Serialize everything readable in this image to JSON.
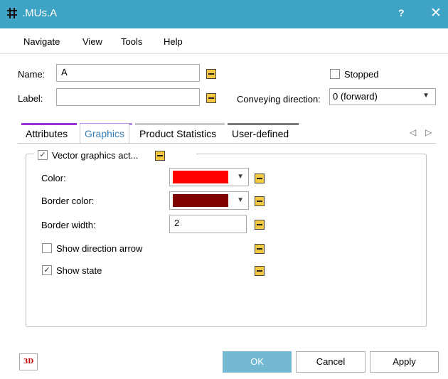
{
  "window": {
    "title": ".MUs.A",
    "help": "?",
    "close": "✕"
  },
  "menu": [
    "Navigate",
    "View",
    "Tools",
    "Help"
  ],
  "form": {
    "name_label": "Name:",
    "name_value": "A",
    "label_label": "Label:",
    "label_value": "",
    "stopped_label": "Stopped",
    "conveying_label": "Conveying direction:",
    "conveying_value": "0 (forward)"
  },
  "tabs": [
    {
      "label": "Attributes",
      "color": "#9b30d9"
    },
    {
      "label": "Graphics",
      "color": "#b48be8"
    },
    {
      "label": "Product Statistics",
      "color": "#c8c8c8"
    },
    {
      "label": "User-defined",
      "color": "#7a7a7a"
    }
  ],
  "tab_nav": {
    "prev": "◁",
    "next": "▷"
  },
  "graphics": {
    "vector_label": "Vector graphics act...",
    "vector_checked": "✓",
    "color_label": "Color:",
    "color_value": "#ff0000",
    "border_color_label": "Border color:",
    "border_color_value": "#800000",
    "border_width_label": "Border width:",
    "border_width_value": "2",
    "show_arrow_label": "Show direction arrow",
    "show_state_label": "Show state",
    "show_state_checked": "✓"
  },
  "footer": {
    "badge_3d": "3D",
    "ok": "OK",
    "cancel": "Cancel",
    "apply": "Apply"
  }
}
